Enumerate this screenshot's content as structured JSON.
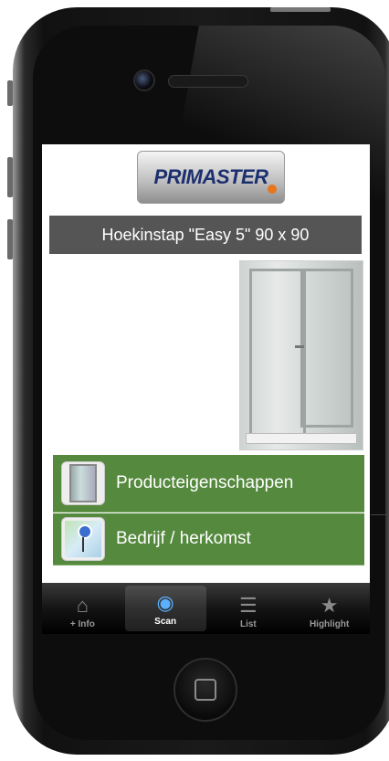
{
  "app": {
    "logo_text": "PRIMASTER",
    "product_title": "Hoekinstap \"Easy 5\" 90 x 90"
  },
  "menu": [
    {
      "label": "Producteigenschappen",
      "icon": "shower-cabin-icon"
    },
    {
      "label": "Bedrijf / herkomst",
      "icon": "map-pin-icon"
    }
  ],
  "tabbar": {
    "tabs": [
      {
        "label": "+ Info",
        "icon": "home-icon",
        "active": false
      },
      {
        "label": "Scan",
        "icon": "camera-icon",
        "active": true
      },
      {
        "label": "List",
        "icon": "list-icon",
        "active": false
      },
      {
        "label": "Highlight",
        "icon": "star-icon",
        "active": false
      }
    ]
  },
  "colors": {
    "menu_green": "#55893e",
    "title_gray": "#555555",
    "logo_blue": "#1c2f6e",
    "logo_orange": "#e8761c",
    "active_tab_icon": "#5ab0ff"
  }
}
